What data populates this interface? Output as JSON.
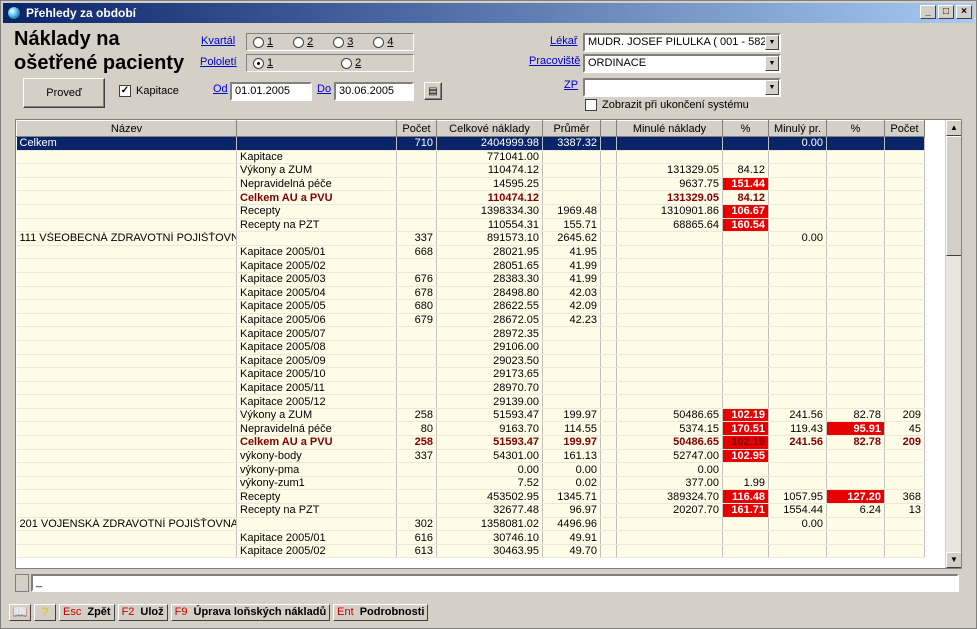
{
  "window": {
    "title": "Přehledy za období"
  },
  "heading": "Náklady na ošetřené pacienty",
  "kvartal": {
    "label": "Kvartál",
    "options": [
      "1",
      "2",
      "3",
      "4"
    ]
  },
  "pololeti": {
    "label": "Pololetí",
    "options": [
      "1",
      "2"
    ],
    "selected": "1"
  },
  "proved_button": "Proveď",
  "kapitace": {
    "label": "Kapitace",
    "checked": true
  },
  "od": {
    "label": "Od",
    "value": "01.01.2005"
  },
  "do": {
    "label": "Do",
    "value": "30.06.2005"
  },
  "lekar": {
    "label": "Lékař",
    "value": "MUDR. JOSEF PILULKA ( 001 - 5825"
  },
  "pracoviste": {
    "label": "Pracoviště",
    "value": "ORDINACE"
  },
  "zp": {
    "label": "ZP",
    "value": ""
  },
  "zobrazit": {
    "label": "Zobrazit při ukončení systému",
    "checked": false
  },
  "table": {
    "columns": [
      "Název",
      "",
      "Počet",
      "Celkové náklady",
      "Průměr",
      "",
      "Minulé náklady",
      "%",
      "Minulý pr.",
      "%",
      "Počet"
    ],
    "rows": [
      {
        "cells": [
          "Celkem",
          "",
          "710",
          "2404999.98",
          "3387.32",
          "",
          "",
          "",
          "0.00",
          "",
          ""
        ],
        "sel": true
      },
      {
        "cells": [
          "",
          "Kapitace",
          "",
          "771041.00",
          "",
          "",
          "",
          "",
          "",
          "",
          ""
        ]
      },
      {
        "cells": [
          "",
          "Výkony a ZUM",
          "",
          "110474.12",
          "",
          "",
          "131329.05",
          "84.12",
          "",
          "",
          ""
        ]
      },
      {
        "cells": [
          "",
          "Nepravidelná péče",
          "",
          "14595.25",
          "",
          "",
          "9637.75",
          "151.44",
          "",
          "",
          ""
        ],
        "hl": [
          7
        ]
      },
      {
        "cells": [
          "",
          "Celkem AU a PVU",
          "",
          "110474.12",
          "",
          "",
          "131329.05",
          "84.12",
          "",
          "",
          ""
        ],
        "bold": true
      },
      {
        "cells": [
          "",
          "Recepty",
          "",
          "1398334.30",
          "1969.48",
          "",
          "1310901.86",
          "106.67",
          "",
          "",
          ""
        ],
        "hl": [
          7
        ]
      },
      {
        "cells": [
          "",
          "Recepty na PZT",
          "",
          "110554.31",
          "155.71",
          "",
          "68865.64",
          "160.54",
          "",
          "",
          ""
        ],
        "hl": [
          7
        ]
      },
      {
        "cells": [
          "111 VŠEOBECNÁ ZDRAVOTNÍ POJIŠŤOVN",
          "",
          "337",
          "891573.10",
          "2645.62",
          "",
          "",
          "",
          "0.00",
          "",
          ""
        ]
      },
      {
        "cells": [
          "",
          "Kapitace 2005/01",
          "668",
          "28021.95",
          "41.95",
          "",
          "",
          "",
          "",
          "",
          ""
        ]
      },
      {
        "cells": [
          "",
          "Kapitace 2005/02",
          "",
          "28051.65",
          "41.99",
          "",
          "",
          "",
          "",
          "",
          ""
        ]
      },
      {
        "cells": [
          "",
          "Kapitace 2005/03",
          "676",
          "28383.30",
          "41.99",
          "",
          "",
          "",
          "",
          "",
          ""
        ]
      },
      {
        "cells": [
          "",
          "Kapitace 2005/04",
          "678",
          "28498.80",
          "42.03",
          "",
          "",
          "",
          "",
          "",
          ""
        ]
      },
      {
        "cells": [
          "",
          "Kapitace 2005/05",
          "680",
          "28622.55",
          "42.09",
          "",
          "",
          "",
          "",
          "",
          ""
        ]
      },
      {
        "cells": [
          "",
          "Kapitace 2005/06",
          "679",
          "28672.05",
          "42.23",
          "",
          "",
          "",
          "",
          "",
          ""
        ]
      },
      {
        "cells": [
          "",
          "Kapitace 2005/07",
          "",
          "28972.35",
          "",
          "",
          "",
          "",
          "",
          "",
          ""
        ]
      },
      {
        "cells": [
          "",
          "Kapitace 2005/08",
          "",
          "29106.00",
          "",
          "",
          "",
          "",
          "",
          "",
          ""
        ]
      },
      {
        "cells": [
          "",
          "Kapitace 2005/09",
          "",
          "29023.50",
          "",
          "",
          "",
          "",
          "",
          "",
          ""
        ]
      },
      {
        "cells": [
          "",
          "Kapitace 2005/10",
          "",
          "29173.65",
          "",
          "",
          "",
          "",
          "",
          "",
          ""
        ]
      },
      {
        "cells": [
          "",
          "Kapitace 2005/11",
          "",
          "28970.70",
          "",
          "",
          "",
          "",
          "",
          "",
          ""
        ]
      },
      {
        "cells": [
          "",
          "Kapitace 2005/12",
          "",
          "29139.00",
          "",
          "",
          "",
          "",
          "",
          "",
          ""
        ]
      },
      {
        "cells": [
          "",
          "Výkony a ZUM",
          "258",
          "51593.47",
          "199.97",
          "",
          "50486.65",
          "102.19",
          "241.56",
          "82.78",
          "209"
        ],
        "hl": [
          7
        ]
      },
      {
        "cells": [
          "",
          "Nepravidelná péče",
          "80",
          "9163.70",
          "114.55",
          "",
          "5374.15",
          "170.51",
          "119.43",
          "95.91",
          "45"
        ],
        "hl": [
          7,
          9
        ]
      },
      {
        "cells": [
          "",
          "Celkem AU a PVU",
          "258",
          "51593.47",
          "199.97",
          "",
          "50486.65",
          "102.19",
          "241.56",
          "82.78",
          "209"
        ],
        "bold": true,
        "hl": [
          7
        ]
      },
      {
        "cells": [
          "",
          "výkony-body",
          "337",
          "54301.00",
          "161.13",
          "",
          "52747.00",
          "102.95",
          "",
          "",
          ""
        ],
        "hl": [
          7
        ]
      },
      {
        "cells": [
          "",
          "výkony-pma",
          "",
          "0.00",
          "0.00",
          "",
          "0.00",
          "",
          "",
          "",
          ""
        ]
      },
      {
        "cells": [
          "",
          "výkony-zum1",
          "",
          "7.52",
          "0.02",
          "",
          "377.00",
          "1.99",
          "",
          "",
          ""
        ]
      },
      {
        "cells": [
          "",
          "Recepty",
          "",
          "453502.95",
          "1345.71",
          "",
          "389324.70",
          "116.48",
          "1057.95",
          "127.20",
          "368"
        ],
        "hl": [
          7,
          9
        ]
      },
      {
        "cells": [
          "",
          "Recepty na PZT",
          "",
          "32677.48",
          "96.97",
          "",
          "20207.70",
          "161.71",
          "1554.44",
          "6.24",
          "13"
        ],
        "hl": [
          7
        ]
      },
      {
        "cells": [
          "201 VOJENSKÁ ZDRAVOTNÍ POJIŠŤOVNA",
          "",
          "302",
          "1358081.02",
          "4496.96",
          "",
          "",
          "",
          "0.00",
          "",
          ""
        ]
      },
      {
        "cells": [
          "",
          "Kapitace 2005/01",
          "616",
          "30746.10",
          "49.91",
          "",
          "",
          "",
          "",
          "",
          ""
        ]
      },
      {
        "cells": [
          "",
          "Kapitace 2005/02",
          "613",
          "30463.95",
          "49.70",
          "",
          "",
          "",
          "",
          "",
          ""
        ]
      }
    ]
  },
  "cmdline": "_",
  "fkeys": [
    {
      "key": "Esc",
      "label": "Zpět"
    },
    {
      "key": "F2",
      "label": "Ulož"
    },
    {
      "key": "F9",
      "label": "Úprava loňských nákladů"
    },
    {
      "key": "Ent",
      "label": "Podrobnosti"
    }
  ]
}
